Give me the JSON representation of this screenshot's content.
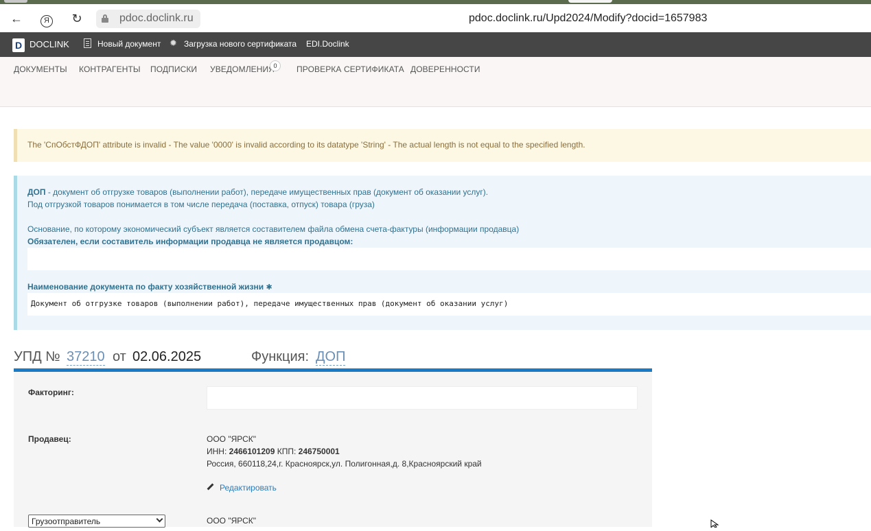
{
  "browser": {
    "domain": "pdoc.doclink.ru",
    "url": "pdoc.doclink.ru/Upd2024/Modify?docid=1657983",
    "yandex_glyph": "Я"
  },
  "navbar": {
    "brand_logo": "D",
    "brand": "DOCLINK",
    "new_doc": "Новый документ",
    "upload_cert": "Загрузка нового сертификата",
    "edi": "EDI.Doclink"
  },
  "subnav": {
    "documents": "ДОКУМЕНТЫ",
    "counterparties": "КОНТРАГЕНТЫ",
    "subscriptions": "ПОДПИСКИ",
    "notifications": "УВЕДОМЛЕНИЯ",
    "notifications_count": "0",
    "cert_check": "ПРОВЕРКА СЕРТИФИКАТА",
    "powers": "ДОВЕРЕННОСТИ"
  },
  "alert": {
    "message": "The 'СпОбстФДОП' attribute is invalid - The value '0000' is invalid according to its datatype 'String' - The actual length is not equal to the specified length."
  },
  "info": {
    "dop_bold": "ДОП",
    "dop_text": " - документ об отгрузке товаров (выполнении работ), передаче имущественных прав (документ об оказании услуг).",
    "line2": "Под отгрузкой товаров понимается в том числе передача (поставка, отпуск) товара (груза)",
    "basis": "Основание, по которому экономический субъект является составителем файла обмена счета-фактуры (информации продавца)",
    "required_note": "Обязателен, если составитель информации продавца не является продавцом:",
    "basis_value": "",
    "doc_name_label": "Наименование документа по факту хозяйственной жизни",
    "required_star": "✱",
    "doc_name_value": "Документ об отгрузке товаров (выполнении работ), передаче имущественных прав (документ об оказании услуг)"
  },
  "doc_header": {
    "upd_label": "УПД №",
    "number": "37210",
    "from": "от",
    "date": "02.06.2025",
    "function_label": "Функция:",
    "function_value": "ДОП"
  },
  "form": {
    "factoring_label": "Факторинг:",
    "factoring_value": "",
    "seller_label": "Продавец:",
    "seller_name": "ООО \"ЯРСК\"",
    "inn_label": "ИНН:",
    "inn": "2466101209",
    "kpp_label": "КПП:",
    "kpp": "246750001",
    "address": "Россия, 660118,24,г. Красноярск,ул. Полигонная,д. 8,Красноярский край",
    "edit_link": "Редактировать",
    "shipper_select": "Грузоотправитель",
    "shipper_name": "ООО \"ЯРСК\""
  }
}
